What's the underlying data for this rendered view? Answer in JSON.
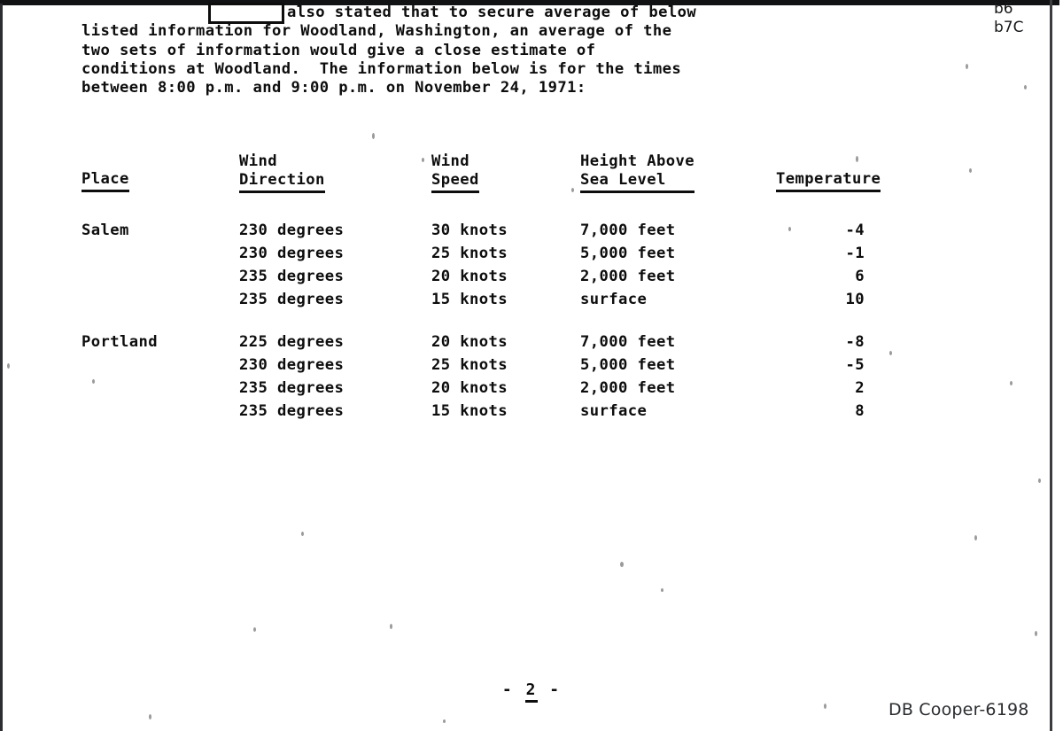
{
  "document": {
    "intro_paragraph_lines": [
      "also stated that to secure average of below",
      "listed information for Woodland, Washington, an average of the",
      "two sets of information would give a close estimate of",
      "conditions at Woodland.  The information below is for the times",
      "between 8:00 p.m. and 9:00 p.m. on November 24, 1971:"
    ],
    "redaction_label": "redacted-name",
    "exemption_codes": [
      "b6",
      "b7C"
    ],
    "page_number_prefix": "-",
    "page_number": "2",
    "page_number_suffix": "-",
    "case_stamp": "DB Cooper-6198"
  },
  "table": {
    "headers": {
      "place": {
        "line1": "",
        "line2": "Place"
      },
      "wind_direction": {
        "line1": "Wind",
        "line2": "Direction"
      },
      "wind_speed": {
        "line1": "Wind",
        "line2": "Speed"
      },
      "height_above_sea_level": {
        "line1": "Height Above",
        "line2": "Sea Level  "
      },
      "temperature": {
        "line1": "",
        "line2": "Temperature"
      }
    },
    "groups": [
      {
        "place": "Salem",
        "rows": [
          {
            "direction": "230 degrees",
            "speed": "30 knots",
            "altitude": "7,000 feet",
            "temperature": "-4"
          },
          {
            "direction": "230 degrees",
            "speed": "25 knots",
            "altitude": "5,000 feet",
            "temperature": "-1"
          },
          {
            "direction": "235 degrees",
            "speed": "20 knots",
            "altitude": "2,000 feet",
            "temperature": "6"
          },
          {
            "direction": "235 degrees",
            "speed": "15 knots",
            "altitude": "surface",
            "temperature": "10"
          }
        ]
      },
      {
        "place": "Portland",
        "rows": [
          {
            "direction": "225 degrees",
            "speed": "20 knots",
            "altitude": "7,000 feet",
            "temperature": "-8"
          },
          {
            "direction": "230 degrees",
            "speed": "25 knots",
            "altitude": "5,000 feet",
            "temperature": "-5"
          },
          {
            "direction": "235 degrees",
            "speed": "20 knots",
            "altitude": "2,000 feet",
            "temperature": "2"
          },
          {
            "direction": "235 degrees",
            "speed": "15 knots",
            "altitude": "surface",
            "temperature": "8"
          }
        ]
      }
    ]
  }
}
